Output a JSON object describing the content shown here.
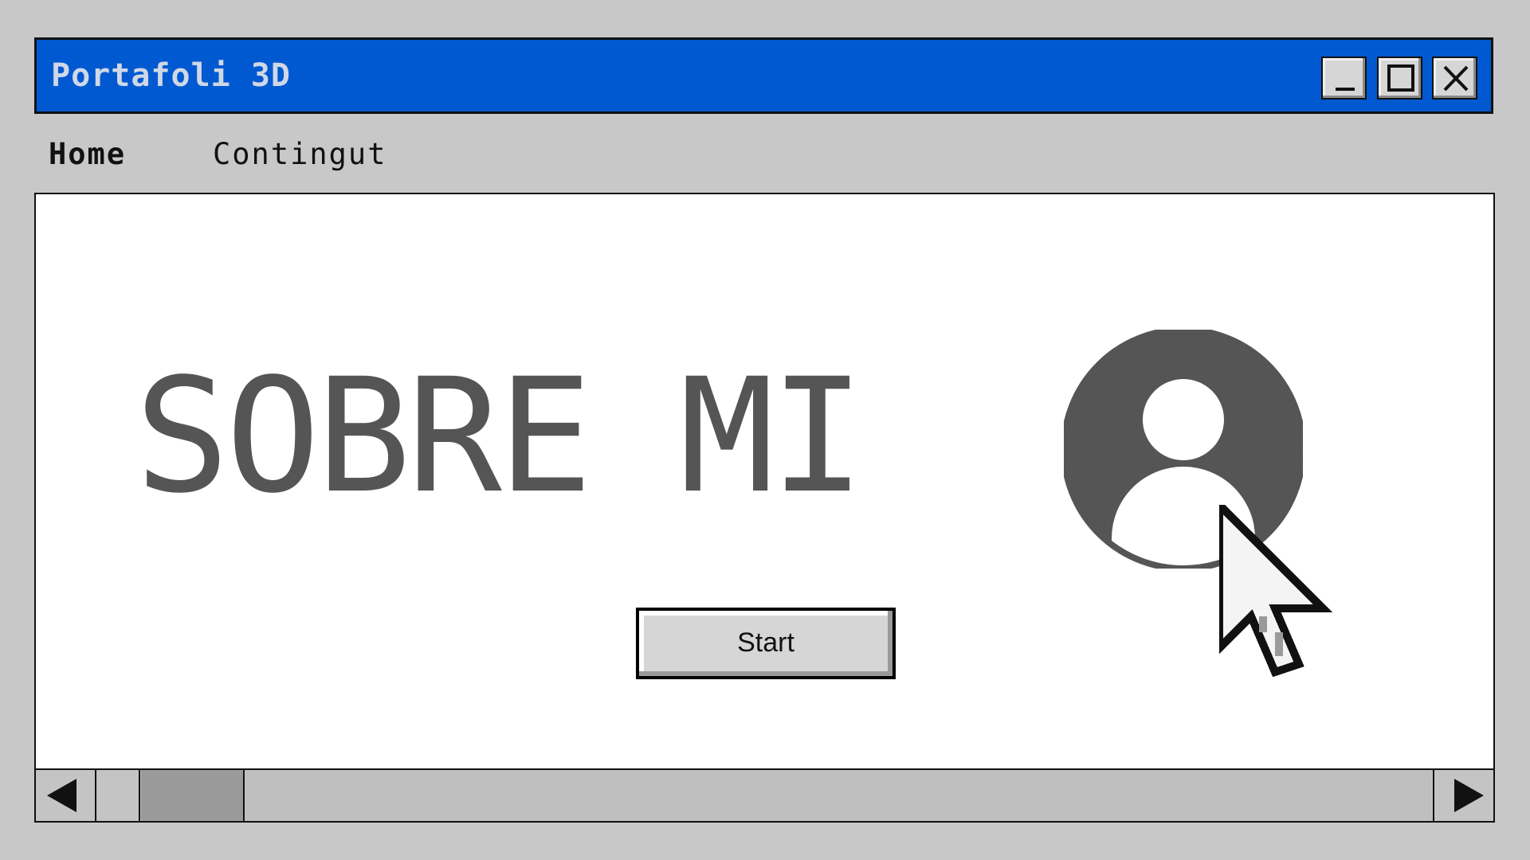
{
  "window": {
    "title": "Portafoli 3D",
    "title_bar_color": "#0059d1",
    "controls": {
      "minimize_icon": "minimize-icon",
      "maximize_icon": "maximize-icon",
      "close_icon": "close-icon"
    }
  },
  "menu": {
    "items": [
      {
        "label": "Home",
        "active": true
      },
      {
        "label": "Contingut",
        "active": false
      }
    ]
  },
  "main": {
    "headline": "SOBRE MI",
    "avatar_icon": "user-avatar-icon",
    "start_label": "Start",
    "cursor_icon": "pointer-cursor-icon",
    "accent_gray": "#555555"
  },
  "scrollbar": {
    "left_icon": "arrow-left-icon",
    "right_icon": "arrow-right-icon",
    "thumb_color": "#9a9a9a"
  }
}
